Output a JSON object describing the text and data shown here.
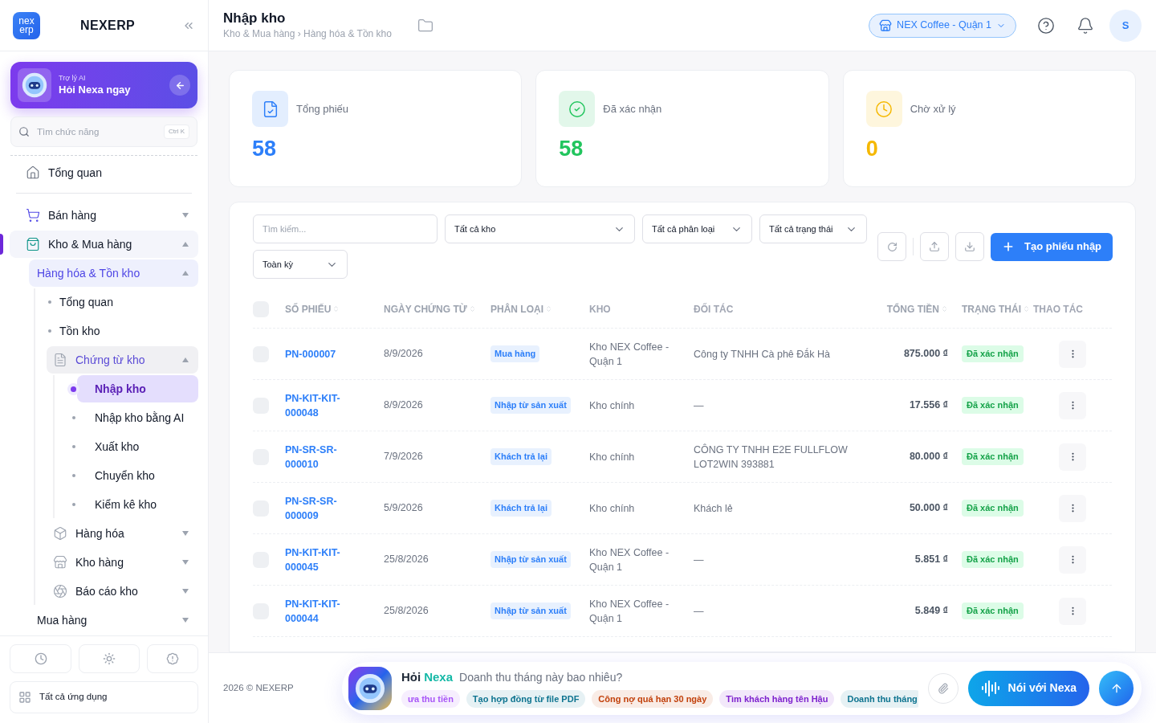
{
  "sidebar": {
    "logo": {
      "lines": [
        "nex",
        "erp"
      ]
    },
    "brand": "NEXERP",
    "ai_card": {
      "caption": "Trợ lý AI",
      "title": "Hỏi Nexa ngay"
    },
    "search": {
      "placeholder": "Tìm chức năng",
      "shortcut": "Ctrl K"
    },
    "nav": [
      {
        "label": "Tổng quan",
        "selected": false
      },
      {
        "label": "Bán hàng",
        "selected": false,
        "expanded": false
      },
      {
        "label": "Kho & Mua hàng",
        "selected": false,
        "expanded": true,
        "children": [
          {
            "label": "Hàng hóa & Tồn kho",
            "selected": false,
            "expanded": true,
            "children": [
              {
                "label": "Tổng quan",
                "selected": false
              },
              {
                "label": "Tồn kho",
                "selected": false
              },
              {
                "label": "Chứng từ kho",
                "selected": false,
                "expanded": true,
                "children": [
                  {
                    "label": "Nhập kho",
                    "selected": true
                  },
                  {
                    "label": "Nhập kho bằng AI",
                    "selected": false
                  },
                  {
                    "label": "Xuất kho",
                    "selected": false
                  },
                  {
                    "label": "Chuyển kho",
                    "selected": false
                  },
                  {
                    "label": "Kiểm kê kho",
                    "selected": false
                  }
                ]
              },
              {
                "label": "Hàng hóa",
                "selected": false,
                "expanded": false
              },
              {
                "label": "Kho hàng",
                "selected": false,
                "expanded": false
              },
              {
                "label": "Báo cáo kho",
                "selected": false,
                "expanded": false
              }
            ]
          },
          {
            "label": "Mua hàng",
            "selected": false,
            "expanded": false
          }
        ]
      }
    ],
    "all_apps": "Tất cả ứng dụng"
  },
  "header": {
    "title": "Nhập kho",
    "breadcrumb": "Kho & Mua hàng › Hàng hóa & Tồn kho",
    "store": "NEX Coffee - Quận 1",
    "avatar": "S"
  },
  "stats": [
    {
      "label": "Tổng phiếu",
      "value": "58",
      "color": "#2d7ff9"
    },
    {
      "label": "Đã xác nhận",
      "value": "58",
      "color": "#22c55e"
    },
    {
      "label": "Chờ xử lý",
      "value": "0",
      "color": "#f5b800"
    }
  ],
  "filters": {
    "search": {
      "placeholder": "Tìm kiếm..."
    },
    "dropdowns": [
      "Tất cả kho",
      "Tất cả phân loại",
      "Tất cả trạng thái",
      "Toàn kỳ"
    ],
    "create_button": "Tạo phiếu nhập"
  },
  "table": {
    "all_checked": false,
    "columns": [
      {
        "label": "SỐ PHIẾU",
        "sortable": true
      },
      {
        "label": "NGÀY CHỨNG TỪ",
        "sortable": true
      },
      {
        "label": "PHÂN LOẠI",
        "sortable": true
      },
      {
        "label": "KHO",
        "sortable": false
      },
      {
        "label": "ĐỐI TÁC",
        "sortable": false
      },
      {
        "label": "TỔNG TIỀN",
        "sortable": true
      },
      {
        "label": "TRẠNG THÁI",
        "sortable": true
      },
      {
        "label": "THAO TÁC",
        "sortable": false
      }
    ],
    "rows": [
      {
        "code": "PN-000007",
        "date": "8/9/2026",
        "category": "Mua hàng",
        "warehouse": "Kho NEX Coffee - Quận 1",
        "partner": "Công ty TNHH Cà phê Đắk Hà",
        "total": "875.000 ₫",
        "status": "Đã xác nhận",
        "checked": false
      },
      {
        "code": "PN-KIT-KIT-000048",
        "date": "8/9/2026",
        "category": "Nhập từ sản xuất",
        "warehouse": "Kho chính",
        "partner": "—",
        "total": "17.556 ₫",
        "status": "Đã xác nhận",
        "checked": false
      },
      {
        "code": "PN-SR-SR-000010",
        "date": "7/9/2026",
        "category": "Khách trả lại",
        "warehouse": "Kho chính",
        "partner": "CÔNG TY TNHH E2E FULLFLOW LOT2WIN 393881",
        "total": "80.000 ₫",
        "status": "Đã xác nhận",
        "checked": false
      },
      {
        "code": "PN-SR-SR-000009",
        "date": "5/9/2026",
        "category": "Khách trả lại",
        "warehouse": "Kho chính",
        "partner": "Khách lẻ",
        "total": "50.000 ₫",
        "status": "Đã xác nhận",
        "checked": false
      },
      {
        "code": "PN-KIT-KIT-000045",
        "date": "25/8/2026",
        "category": "Nhập từ sản xuất",
        "warehouse": "Kho NEX Coffee - Quận 1",
        "partner": "—",
        "total": "5.851 ₫",
        "status": "Đã xác nhận",
        "checked": false
      },
      {
        "code": "PN-KIT-KIT-000044",
        "date": "25/8/2026",
        "category": "Nhập từ sản xuất",
        "warehouse": "Kho NEX Coffee - Quận 1",
        "partner": "—",
        "total": "5.849 ₫",
        "status": "Đã xác nhận",
        "checked": false
      }
    ]
  },
  "footer": {
    "copyright": "2026 © NEXERP"
  },
  "assistant": {
    "title_prefix": "Hỏi",
    "title_brand": "Nexa",
    "placeholder": "Doanh thu tháng này bao nhiêu?",
    "voice_button": "Nói với Nexa",
    "suggestions": [
      {
        "label": "ưa thu tiền",
        "color": "#a855f7"
      },
      {
        "label": "Tạo hợp đồng từ file PDF",
        "color": "#0e7490"
      },
      {
        "label": "Công nợ quá hạn 30 ngày",
        "color": "#c2410c"
      },
      {
        "label": "Tìm khách hàng tên Hậu",
        "color": "#7e22ce"
      },
      {
        "label": "Doanh thu tháng",
        "color": "#0e7490"
      }
    ]
  }
}
